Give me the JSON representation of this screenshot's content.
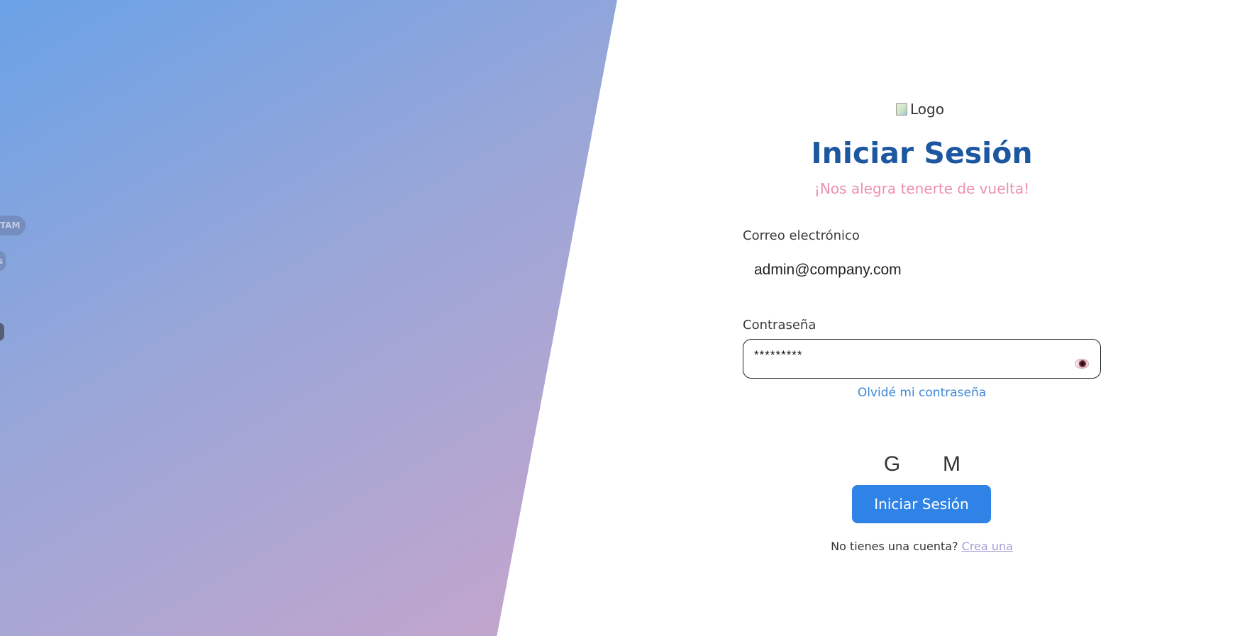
{
  "hero": {
    "pill_1": "TAM",
    "pill_2": "ss"
  },
  "login": {
    "logo_alt": "Logo",
    "title": "Iniciar Sesión",
    "subtitle": "¡Nos alegra tenerte de vuelta!",
    "email": {
      "label": "Correo electrónico",
      "value": "admin@company.com"
    },
    "password": {
      "label": "Contraseña",
      "value": "*********"
    },
    "forgot_password": "Olvidé mi contraseña",
    "providers": [
      {
        "label": "G",
        "icon": "google-icon"
      },
      {
        "label": "M",
        "icon": "microsoft-icon"
      }
    ],
    "submit_label": "Iniciar Sesión",
    "signup_prompt": "No tienes una cuenta?",
    "signup_link": "Crea una"
  },
  "colors": {
    "primary": "#2f82e6",
    "title": "#1c57a0",
    "subtitle": "#ef8fac",
    "link": "#3d86d8",
    "signup_link": "#a99ed9"
  }
}
